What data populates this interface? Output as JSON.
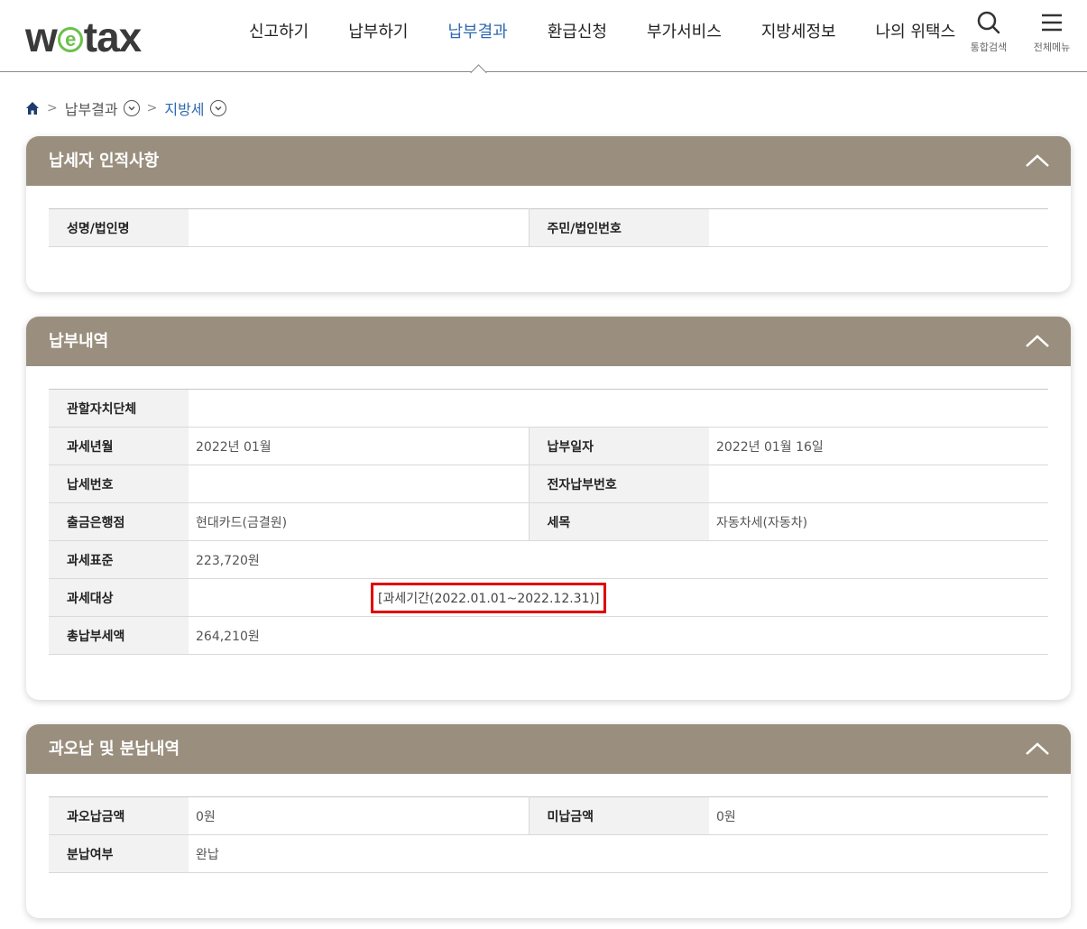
{
  "header": {
    "logo": {
      "pre": "w",
      "e": "e",
      "post": "tax"
    },
    "nav": [
      "신고하기",
      "납부하기",
      "납부결과",
      "환급신청",
      "부가서비스",
      "지방세정보",
      "나의 위택스"
    ],
    "active_nav_index": 2,
    "search_label": "통합검색",
    "menu_label": "전체메뉴"
  },
  "breadcrumb": {
    "level1": "납부결과",
    "level2": "지방세"
  },
  "panel1": {
    "title": "납세자 인적사항",
    "name_label": "성명/법인명",
    "name_value": "",
    "id_label": "주민/법인번호",
    "id_value": ""
  },
  "panel2": {
    "title": "납부내역",
    "rows": {
      "region_label": "관할자치단체",
      "region_value": "",
      "tax_month_label": "과세년월",
      "tax_month_value": "2022년 01월",
      "pay_date_label": "납부일자",
      "pay_date_value": "2022년 01월 16일",
      "tax_no_label": "납세번호",
      "tax_no_value": "",
      "epay_no_label": "전자납부번호",
      "epay_no_value": "",
      "bank_label": "출금은행점",
      "bank_value": "현대카드(금결원)",
      "item_label": "세목",
      "item_value": "자동차세(자동차)",
      "base_label": "과세표준",
      "base_value": "223,720원",
      "target_label": "과세대상",
      "target_value": "[과세기간(2022.01.01~2022.12.31)]",
      "total_label": "총납부세액",
      "total_value": "264,210원"
    }
  },
  "panel3": {
    "title": "과오납 및 분납내역",
    "overpaid_label": "과오납금액",
    "overpaid_value": "0원",
    "unpaid_label": "미납금액",
    "unpaid_value": "0원",
    "installment_label": "분납여부",
    "installment_value": "완납"
  }
}
